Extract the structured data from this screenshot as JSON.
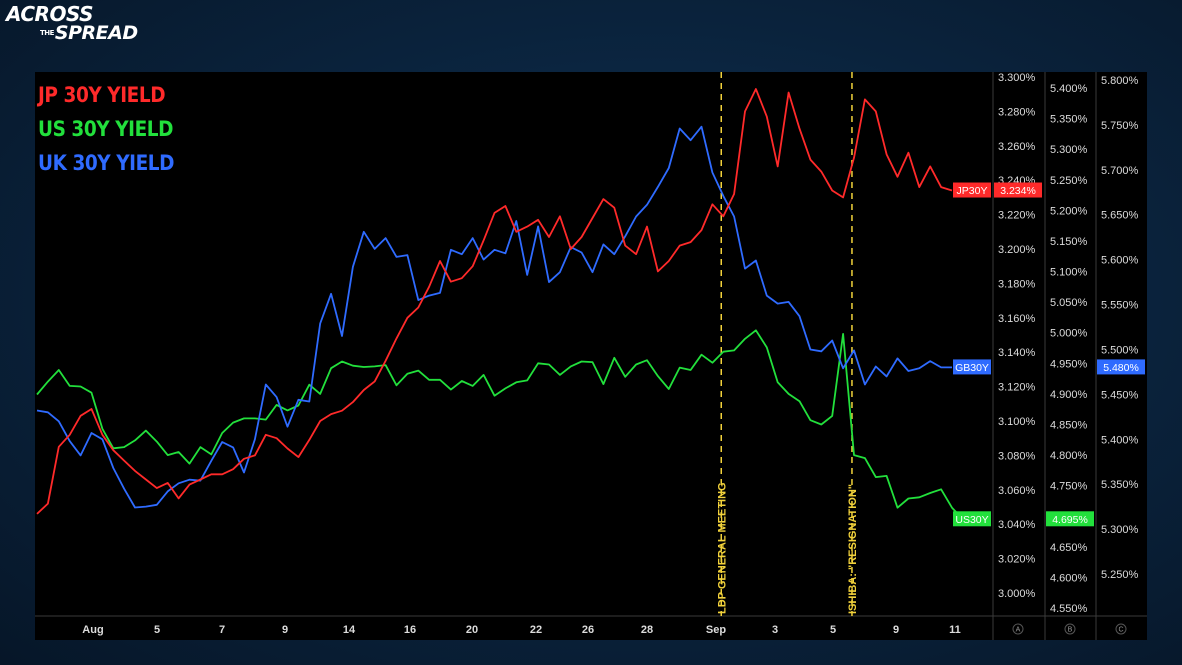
{
  "logo": {
    "line1": "ACROSS",
    "the": "THE",
    "line2": "SPREAD"
  },
  "legend": [
    {
      "label": "JP 30Y YIELD",
      "color": "#ff2a2a"
    },
    {
      "label": "US 30Y YIELD",
      "color": "#22e03c"
    },
    {
      "label": "UK 30Y YIELD",
      "color": "#2f6bff"
    }
  ],
  "colors": {
    "jp": "#ff2a2a",
    "us": "#22e03c",
    "uk": "#2f6bff",
    "event": "#f2d23b",
    "background": "#000000"
  },
  "chart_data": {
    "type": "line",
    "x_labels": [
      "Aug",
      "5",
      "7",
      "9",
      "14",
      "16",
      "20",
      "22",
      "26",
      "28",
      "Sep",
      "3",
      "5",
      "9",
      "11"
    ],
    "axes": [
      {
        "id": "A",
        "series": "JP30Y",
        "ticks": [
          "3.300%",
          "3.280%",
          "3.260%",
          "3.240%",
          "3.220%",
          "3.200%",
          "3.180%",
          "3.160%",
          "3.140%",
          "3.120%",
          "3.100%",
          "3.080%",
          "3.060%",
          "3.040%",
          "3.020%",
          "3.000%"
        ],
        "ylim": [
          2.99,
          3.305
        ]
      },
      {
        "id": "B",
        "series": "US30Y",
        "ticks": [
          "5.400%",
          "5.350%",
          "5.300%",
          "5.250%",
          "5.200%",
          "5.150%",
          "5.100%",
          "5.050%",
          "5.000%",
          "4.950%",
          "4.900%",
          "4.850%",
          "4.800%",
          "4.750%",
          "4.700%",
          "4.650%",
          "4.600%",
          "4.550%"
        ],
        "ylim": [
          4.54,
          5.42
        ]
      },
      {
        "id": "C",
        "series": "GB30Y",
        "ticks": [
          "5.800%",
          "5.750%",
          "5.700%",
          "5.650%",
          "5.600%",
          "5.550%",
          "5.500%",
          "5.450%",
          "5.400%",
          "5.350%",
          "5.300%",
          "5.250%"
        ],
        "ylim": [
          5.18,
          5.815
        ]
      }
    ],
    "series": [
      {
        "name": "JP 30Y YIELD",
        "axis": "A",
        "tag": "JP30Y",
        "last": "3.234%",
        "values": [
          3.046,
          3.052,
          3.085,
          3.092,
          3.103,
          3.107,
          3.092,
          3.083,
          3.077,
          3.071,
          3.066,
          3.061,
          3.064,
          3.055,
          3.063,
          3.066,
          3.069,
          3.069,
          3.072,
          3.078,
          3.08,
          3.092,
          3.09,
          3.084,
          3.079,
          3.089,
          3.1,
          3.104,
          3.106,
          3.111,
          3.118,
          3.123,
          3.135,
          3.148,
          3.16,
          3.166,
          3.178,
          3.193,
          3.181,
          3.183,
          3.19,
          3.205,
          3.221,
          3.225,
          3.21,
          3.213,
          3.217,
          3.207,
          3.219,
          3.2,
          3.207,
          3.218,
          3.229,
          3.224,
          3.202,
          3.197,
          3.213,
          3.187,
          3.193,
          3.202,
          3.204,
          3.211,
          3.226,
          3.219,
          3.232,
          3.28,
          3.293,
          3.277,
          3.248,
          3.291,
          3.27,
          3.252,
          3.245,
          3.234,
          3.23,
          3.253,
          3.287,
          3.28,
          3.255,
          3.242,
          3.256,
          3.236,
          3.248,
          3.236,
          3.234
        ]
      },
      {
        "name": "US 30Y YIELD",
        "axis": "B",
        "tag": "US30Y",
        "last": "4.695%",
        "values": [
          4.899,
          4.92,
          4.939,
          4.913,
          4.912,
          4.902,
          4.843,
          4.811,
          4.813,
          4.824,
          4.84,
          4.822,
          4.8,
          4.805,
          4.786,
          4.813,
          4.801,
          4.836,
          4.853,
          4.86,
          4.86,
          4.858,
          4.882,
          4.873,
          4.881,
          4.915,
          4.9,
          4.942,
          4.953,
          4.946,
          4.944,
          4.945,
          4.947,
          4.914,
          4.933,
          4.938,
          4.923,
          4.923,
          4.907,
          4.921,
          4.913,
          4.931,
          4.897,
          4.909,
          4.919,
          4.922,
          4.95,
          4.948,
          4.931,
          4.945,
          4.953,
          4.952,
          4.916,
          4.959,
          4.928,
          4.948,
          4.955,
          4.929,
          4.908,
          4.943,
          4.939,
          4.964,
          4.951,
          4.969,
          4.971,
          4.99,
          5.004,
          4.976,
          4.919,
          4.9,
          4.888,
          4.857,
          4.85,
          4.864,
          4.998,
          4.8,
          4.795,
          4.764,
          4.766,
          4.714,
          4.729,
          4.731,
          4.738,
          4.744,
          4.714,
          4.695
        ]
      },
      {
        "name": "UK 30Y YIELD",
        "axis": "C",
        "tag": "GB30Y",
        "last": "5.480%",
        "values": [
          5.432,
          5.43,
          5.42,
          5.398,
          5.382,
          5.407,
          5.4,
          5.368,
          5.345,
          5.324,
          5.325,
          5.327,
          5.342,
          5.351,
          5.355,
          5.354,
          5.376,
          5.397,
          5.391,
          5.363,
          5.4,
          5.461,
          5.447,
          5.414,
          5.444,
          5.442,
          5.529,
          5.562,
          5.515,
          5.592,
          5.631,
          5.612,
          5.624,
          5.603,
          5.605,
          5.555,
          5.56,
          5.563,
          5.611,
          5.606,
          5.624,
          5.6,
          5.611,
          5.607,
          5.643,
          5.583,
          5.637,
          5.575,
          5.586,
          5.614,
          5.608,
          5.586,
          5.617,
          5.606,
          5.626,
          5.648,
          5.661,
          5.681,
          5.702,
          5.746,
          5.733,
          5.748,
          5.697,
          5.671,
          5.648,
          5.59,
          5.599,
          5.56,
          5.551,
          5.553,
          5.537,
          5.5,
          5.498,
          5.51,
          5.479,
          5.499,
          5.461,
          5.481,
          5.47,
          5.49,
          5.476,
          5.479,
          5.487,
          5.48,
          5.48
        ]
      }
    ],
    "events": [
      {
        "label": "LDP GENERAL MEETING",
        "x_index": 63
      },
      {
        "label": "ISHIBA: \"RESIGNATION\"",
        "x_index": 75
      }
    ],
    "axis_footer": [
      "A",
      "B",
      "C"
    ],
    "grid": false
  }
}
